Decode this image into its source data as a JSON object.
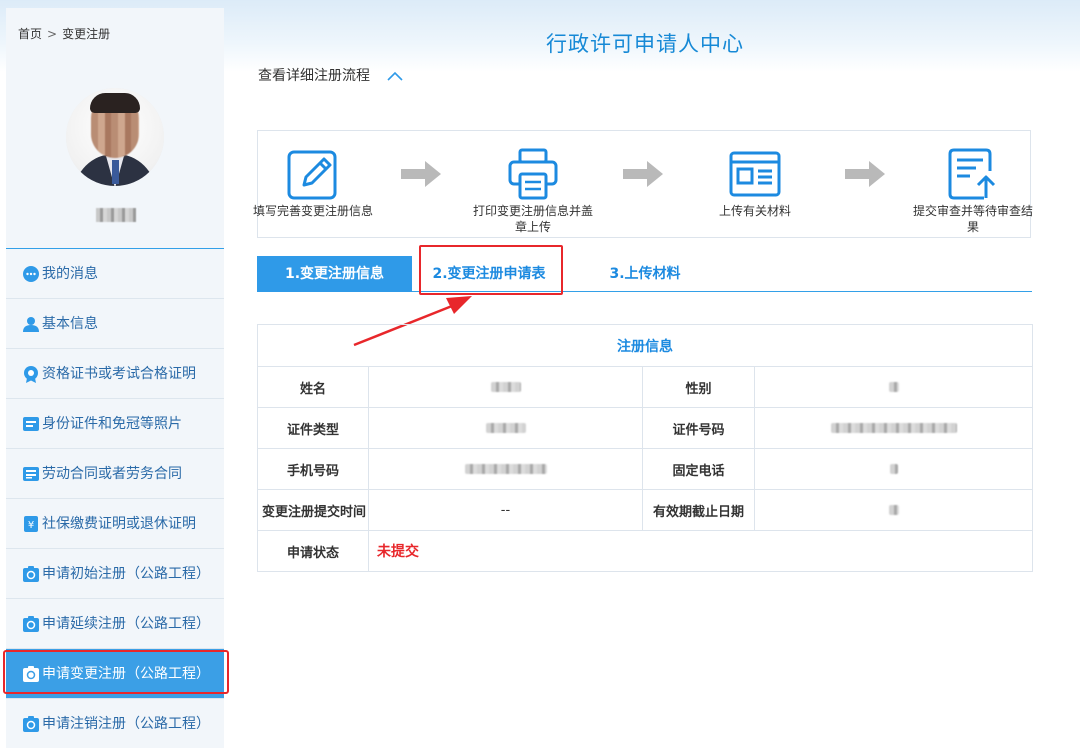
{
  "page": {
    "title": "行政许可申请人中心"
  },
  "breadcrumb": {
    "home": "首页",
    "separator": ">",
    "current": "变更注册"
  },
  "menu": [
    {
      "label": "我的消息",
      "icon": "message-icon"
    },
    {
      "label": "基本信息",
      "icon": "user-icon"
    },
    {
      "label": "资格证书或考试合格证明",
      "icon": "certificate-icon"
    },
    {
      "label": "身份证件和免冠等照片",
      "icon": "id-card-icon"
    },
    {
      "label": "劳动合同或者劳务合同",
      "icon": "contract-icon"
    },
    {
      "label": "社保缴费证明或退休证明",
      "icon": "social-security-icon"
    },
    {
      "label": "申请初始注册（公路工程）",
      "icon": "apply-icon"
    },
    {
      "label": "申请延续注册（公路工程）",
      "icon": "apply-icon"
    },
    {
      "label": "申请变更注册（公路工程）",
      "icon": "apply-icon",
      "active": true
    },
    {
      "label": "申请注销注册（公路工程）",
      "icon": "apply-icon"
    }
  ],
  "flow": {
    "toggle_label": "查看详细注册流程"
  },
  "steps": [
    {
      "label": "填写完善变更注册信息",
      "icon": "edit-form-icon"
    },
    {
      "label": "打印变更注册信息并盖章上传",
      "icon": "printer-icon"
    },
    {
      "label": "上传有关材料",
      "icon": "upload-document-icon"
    },
    {
      "label": "提交审查并等待审查结果",
      "icon": "submit-review-icon"
    }
  ],
  "tabs": [
    {
      "label": "1.变更注册信息",
      "active": true
    },
    {
      "label": "2.变更注册申请表",
      "active": false
    },
    {
      "label": "3.上传材料",
      "active": false
    }
  ],
  "info": {
    "section_title": "注册信息",
    "labels": {
      "name": "姓名",
      "gender": "性别",
      "id_type": "证件类型",
      "id_number": "证件号码",
      "mobile": "手机号码",
      "phone": "固定电话",
      "submit_time": "变更注册提交时间",
      "expiry": "有效期截止日期",
      "status": "申请状态"
    },
    "values": {
      "submit_time": "--",
      "status": "未提交"
    }
  },
  "colors": {
    "accent": "#2f9ae8",
    "highlight": "#e8272b",
    "menu_text": "#2a6aa8"
  }
}
